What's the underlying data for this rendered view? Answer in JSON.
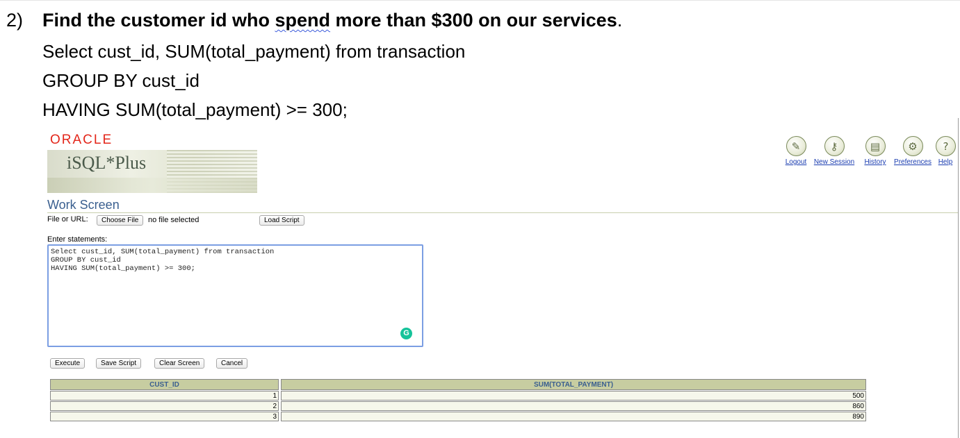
{
  "question": {
    "number": "2)",
    "text_before": "Find the customer id who ",
    "text_spend": "spend",
    "text_after": " more than $300 on our services",
    "period": "."
  },
  "sql_lines": [
    "Select cust_id, SUM(total_payment) from transaction",
    "GROUP BY cust_id",
    "HAVING SUM(total_payment) >= 300;"
  ],
  "app": {
    "vendor_logo": "ORACLE",
    "product_title": "iSQL*Plus",
    "colors": {
      "logo_red": "#e3261a",
      "title_blue": "#3a5f8f",
      "link_blue": "#1a3cb0",
      "header_olive": "#c7cda1"
    }
  },
  "nav": [
    {
      "label": "Logout",
      "icon": "logout-key-icon",
      "glyph": "✎"
    },
    {
      "label": "New Session",
      "icon": "new-session-key-icon",
      "glyph": "⚷"
    },
    {
      "label": "History",
      "icon": "history-document-icon",
      "glyph": "▤"
    },
    {
      "label": "Preferences",
      "icon": "preferences-icon",
      "glyph": "⚙"
    },
    {
      "label": "Help",
      "icon": "help-question-icon",
      "glyph": "?"
    }
  ],
  "work_screen": {
    "title": "Work Screen",
    "file_label": "File or URL:",
    "choose_file_label": "Choose File",
    "no_file_text": "no file selected",
    "load_script_label": "Load Script",
    "enter_statements_label": "Enter statements:",
    "statements_value": "Select cust_id, SUM(total_payment) from transaction\nGROUP BY cust_id\nHAVING SUM(total_payment) >= 300;",
    "buttons": {
      "execute": "Execute",
      "save_script": "Save Script",
      "clear_screen": "Clear Screen",
      "cancel": "Cancel"
    }
  },
  "results": {
    "columns": [
      "CUST_ID",
      "SUM(TOTAL_PAYMENT)"
    ],
    "rows": [
      [
        "1",
        "500"
      ],
      [
        "2",
        "860"
      ],
      [
        "3",
        "890"
      ]
    ]
  }
}
